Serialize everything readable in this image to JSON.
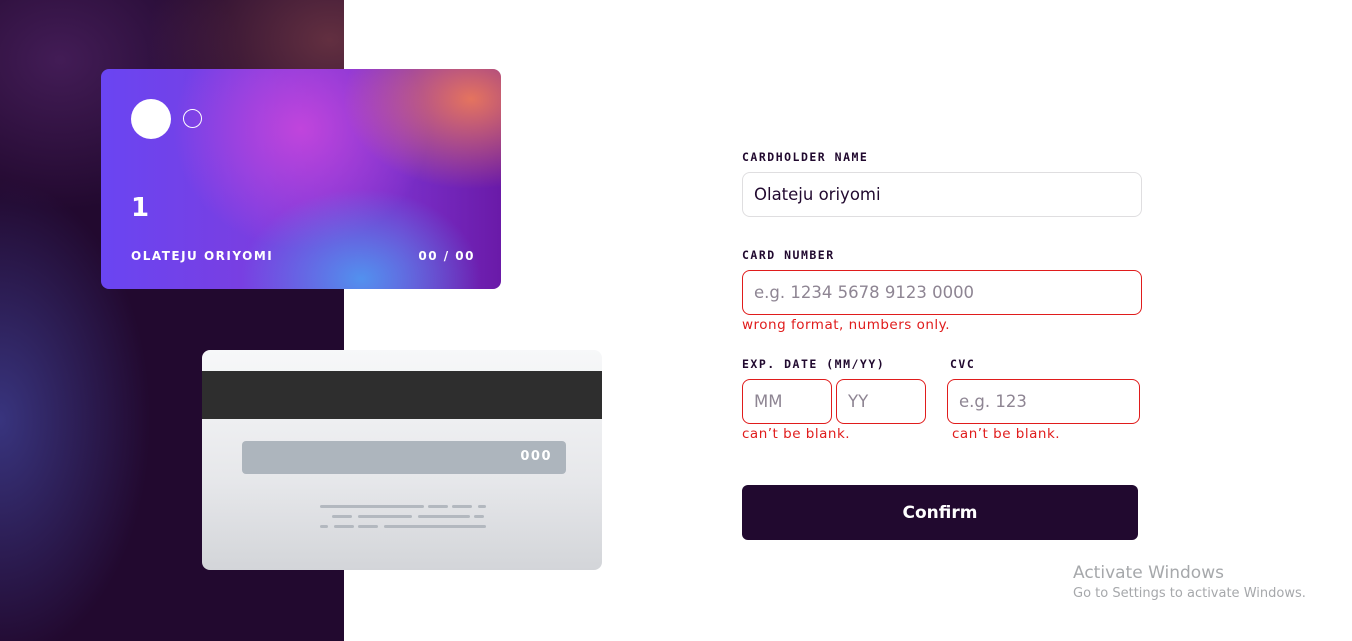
{
  "card_front": {
    "number": "1",
    "holder_name": "OLATEJU ORIYOMI",
    "expiry": "00 / 00"
  },
  "card_back": {
    "cvc": "000"
  },
  "form": {
    "cardholder": {
      "label": "CARDHOLDER NAME",
      "value": "Olateju oriyomi"
    },
    "card_number": {
      "label": "CARD NUMBER",
      "placeholder": "e.g. 1234 5678 9123 0000",
      "value": "",
      "error": "wrong format, numbers only."
    },
    "exp_date": {
      "label": "EXP. DATE (MM/YY)",
      "month_placeholder": "MM",
      "year_placeholder": "YY",
      "error": "can’t be blank."
    },
    "cvc": {
      "label": "CVC",
      "placeholder": "e.g. 123",
      "error": "can’t be blank."
    },
    "confirm_label": "Confirm"
  },
  "watermark": {
    "title": "Activate Windows",
    "subtitle": "Go to Settings to activate Windows."
  },
  "colors": {
    "dark": "#21092f",
    "error": "#e01c1c",
    "input_border": "#dfdee0"
  }
}
